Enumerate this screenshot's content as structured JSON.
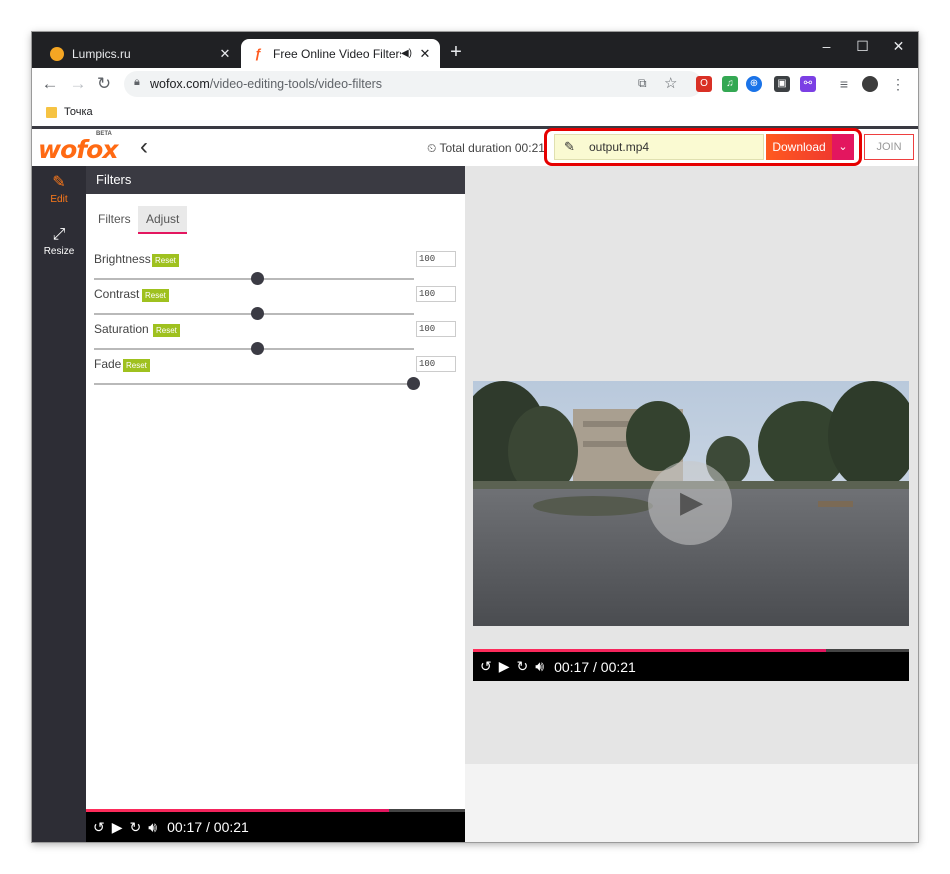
{
  "browser": {
    "tabs": [
      {
        "title": "Lumpics.ru",
        "active": false,
        "favicon_color": "#f5a623"
      },
      {
        "title": "Free Online Video Filters | W",
        "active": true,
        "favicon_color": "#ff5a1f"
      }
    ],
    "new_tab": "+",
    "window_controls": {
      "minimize": "–",
      "maximize": "☐",
      "close": "✕"
    },
    "url_host": "wofox.com",
    "url_path": "/video-editing-tools/video-filters",
    "bookmark": "Точка"
  },
  "app": {
    "logo_text": "wofox",
    "logo_beta": "BETA",
    "total_duration_label": "Total duration 00:21",
    "filename": "output.mp4",
    "download_label": "Download",
    "join_label": "JOIN",
    "rail": [
      {
        "label": "Edit",
        "icon": "edit-icon",
        "active": true
      },
      {
        "label": "Resize",
        "icon": "resize-icon",
        "active": false
      }
    ],
    "panel_title": "Filters",
    "subtabs": [
      "Filters",
      "Adjust"
    ],
    "active_subtab": "Adjust",
    "reset_label": "Reset",
    "sliders": [
      {
        "label": "Brightness",
        "value": "100",
        "position": 0.5
      },
      {
        "label": "Contrast",
        "value": "100",
        "position": 0.5
      },
      {
        "label": "Saturation",
        "value": "100",
        "position": 0.5
      },
      {
        "label": "Fade",
        "value": "100",
        "position": 1.0
      }
    ],
    "player": {
      "time": "00:17 / 00:21",
      "progress": 0.81
    },
    "accent": "#e3165f",
    "download_color": "#ff5a1f"
  }
}
